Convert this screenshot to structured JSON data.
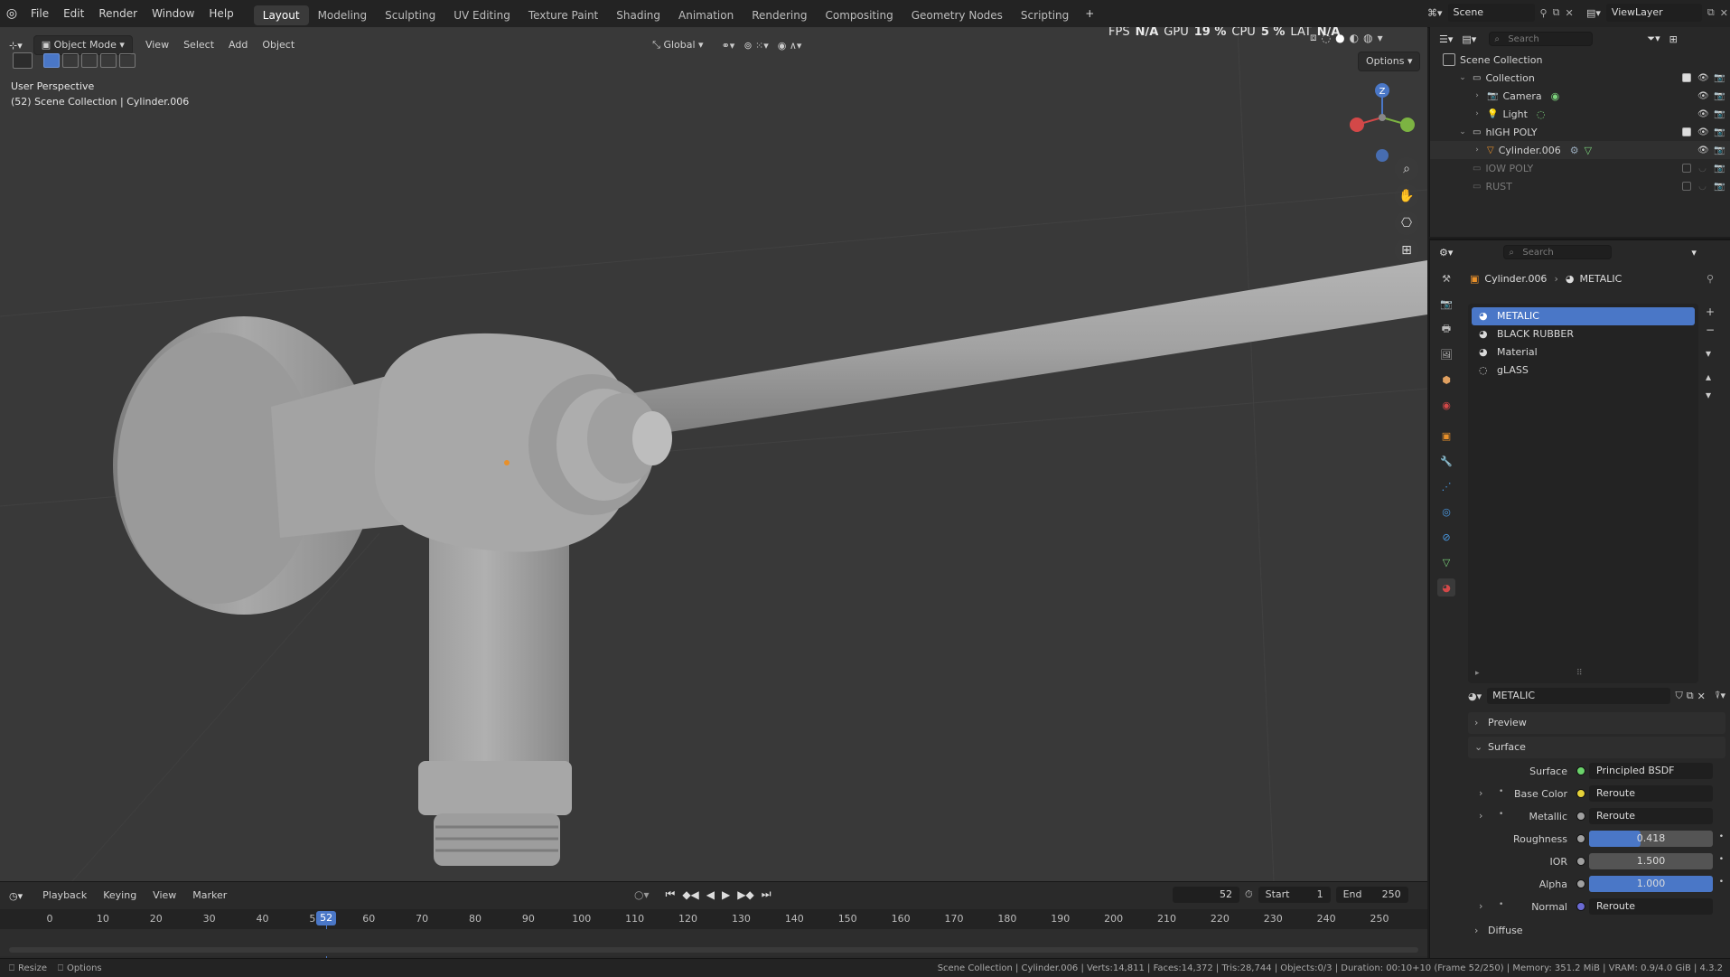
{
  "menus": [
    "File",
    "Edit",
    "Render",
    "Window",
    "Help"
  ],
  "workspaces": [
    "Layout",
    "Modeling",
    "Sculpting",
    "UV Editing",
    "Texture Paint",
    "Shading",
    "Animation",
    "Rendering",
    "Compositing",
    "Geometry Nodes",
    "Scripting"
  ],
  "active_workspace": "Layout",
  "add_workspace": "+",
  "scene": {
    "name": "Scene",
    "view_layer": "ViewLayer"
  },
  "viewport": {
    "mode": "Object Mode",
    "menu": [
      "View",
      "Select",
      "Add",
      "Object"
    ],
    "transform": "Global",
    "overlay_info": "User Perspective",
    "collection_info": "(52) Scene Collection | Cylinder.006",
    "options": "Options",
    "perf": {
      "fps_label": "FPS",
      "fps": "N/A",
      "gpu_label": "GPU",
      "gpu": "19 %",
      "cpu_label": "CPU",
      "cpu": "5 %",
      "lat_label": "LAT",
      "lat": "N/A"
    },
    "gizmo": {
      "z": "Z"
    }
  },
  "timeline": {
    "menu": [
      "Playback",
      "Keying",
      "View",
      "Marker"
    ],
    "current_frame": "52",
    "start_label": "Start",
    "start": "1",
    "end_label": "End",
    "end": "250",
    "ticks": [
      "0",
      "10",
      "20",
      "30",
      "40",
      "50",
      "60",
      "70",
      "80",
      "90",
      "100",
      "110",
      "120",
      "130",
      "140",
      "150",
      "160",
      "170",
      "180",
      "190",
      "200",
      "210",
      "220",
      "230",
      "240",
      "250"
    ]
  },
  "outliner": {
    "search_placeholder": "Search",
    "root": "Scene Collection",
    "rows": [
      {
        "label": "Collection",
        "indent": 1,
        "type": "collection",
        "checked": true
      },
      {
        "label": "Camera",
        "indent": 2,
        "type": "camera"
      },
      {
        "label": "Light",
        "indent": 2,
        "type": "light"
      },
      {
        "label": "hIGH POLY",
        "indent": 1,
        "type": "collection",
        "checked": true
      },
      {
        "label": "Cylinder.006",
        "indent": 2,
        "type": "mesh",
        "selected": true
      },
      {
        "label": "lOW POLY",
        "indent": 1,
        "type": "collection",
        "checked": false,
        "dim": true
      },
      {
        "label": "RUST",
        "indent": 1,
        "type": "collection",
        "checked": false,
        "dim": true
      }
    ]
  },
  "properties": {
    "search_placeholder": "Search",
    "breadcrumb": {
      "object": "Cylinder.006",
      "material": "METALIC"
    },
    "materials": [
      "METALIC",
      "BLACK RUBBER",
      "Material",
      "gLASS"
    ],
    "active_material": "METALIC",
    "material_slot_name": "METALIC",
    "sections": {
      "preview": "Preview",
      "surface": "Surface",
      "diffuse": "Diffuse"
    },
    "surface_rows": [
      {
        "label": "Surface",
        "value": "Principled BSDF",
        "dot": "#6bd36b",
        "kind": "field"
      },
      {
        "label": "Base Color",
        "value": "Reroute",
        "dot": "#e6d23a",
        "kind": "field",
        "expand": true
      },
      {
        "label": "Metallic",
        "value": "Reroute",
        "dot": "#a0a0a0",
        "kind": "field",
        "expand": true
      },
      {
        "label": "Roughness",
        "value": "0.418",
        "dot": "#a0a0a0",
        "kind": "slider",
        "fill": 0.418
      },
      {
        "label": "IOR",
        "value": "1.500",
        "dot": "#a0a0a0",
        "kind": "slider",
        "fill": 0
      },
      {
        "label": "Alpha",
        "value": "1.000",
        "dot": "#a0a0a0",
        "kind": "slider",
        "fill": 1
      },
      {
        "label": "Normal",
        "value": "Reroute",
        "dot": "#6b6bd3",
        "kind": "field",
        "expand": true
      }
    ]
  },
  "statusbar": {
    "left": [
      "Resize",
      "Options"
    ],
    "right": "Scene Collection | Cylinder.006 | Verts:14,811 | Faces:14,372 | Tris:28,744 | Objects:0/3 | Duration: 00:10+10 (Frame 52/250) | Memory: 351.2 MiB | VRAM: 0.9/4.0 GiB | 4.3.2"
  },
  "colors": {
    "accent": "#4a77c7",
    "viewport_bg": "#393939",
    "panel_bg": "#282828",
    "header_bg": "#232323",
    "mesh_gray": "#9a9a9a",
    "playhead": "#4a77c7"
  }
}
